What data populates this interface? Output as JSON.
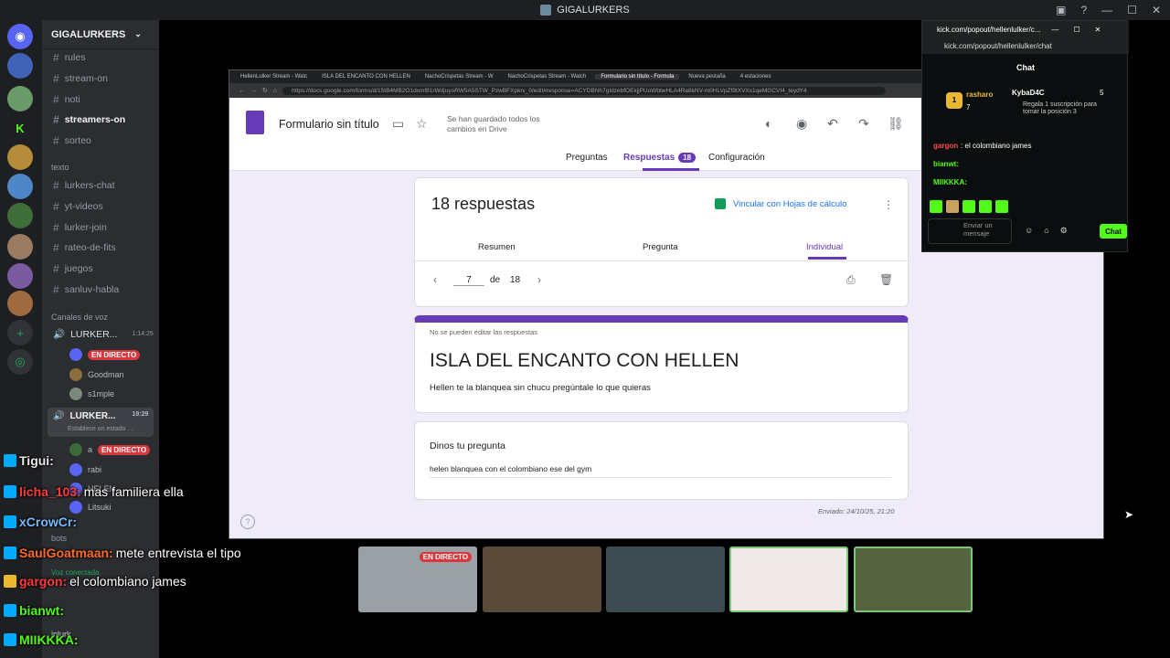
{
  "window": {
    "title": "GIGALURKERS"
  },
  "discord": {
    "server_name": "GIGALURKERS",
    "channels": [
      "rules",
      "stream-on",
      "noti",
      "streamers-on",
      "sorteo"
    ],
    "active_channel": "streamers-on",
    "text_category": "texto",
    "text_channels": [
      "lurkers-chat",
      "yt-videos",
      "lurker-join",
      "rateo-de-fits",
      "juegos",
      "sanluv-habla"
    ],
    "voice_category": "Canales de voz",
    "voice1": {
      "name": "LURKER...",
      "time": "1:14:25",
      "users": [
        "EN DIRECTO",
        "Goodman",
        "s1mple"
      ]
    },
    "voice2": {
      "name": "LURKER...",
      "time": "19:29",
      "status": "Establece un estado ..."
    },
    "voice2_users": [
      "a",
      "rabi",
      "HELEN",
      "Litsuki"
    ],
    "bots_label": "bots",
    "voice_connected": "Voz conectada",
    "live_badge": "EN DIRECTO",
    "user_footer": "inlurk"
  },
  "browser": {
    "tabs": [
      "HellenLulker Stream - Watc",
      "ISLA DEL ENCANTO CON HELLEN",
      "NachoCrispetas Stream - W",
      "NachoCrispetas Stream - Watch",
      "Formulario sin título - Formula",
      "Nueva pestaña",
      "4 estaciones"
    ],
    "url": "https://docs.google.com/forms/d/15tB4MB2O1dxmf81rWdjuyoRW5A5STW_PzwBFXpkrv_0/edit#response=ACYDBNh7gIdzebfOEkjjPUoWbtwHLA4Ra8kNV-m0HLVpZf9tXVXx1qeMGCVI4_teydY4"
  },
  "form": {
    "title": "Formulario sin título",
    "saved_status": "Se han guardado todos los cambios en Drive",
    "nav_tabs": [
      "Preguntas",
      "Respuestas",
      "Configuración"
    ],
    "response_count_badge": "18",
    "responses_heading": "18 respuestas",
    "sheet_link": "Vincular con Hojas de cálculo",
    "sub_tabs": [
      "Resumen",
      "Pregunta",
      "Individual"
    ],
    "pager": {
      "current": "7",
      "of_label": "de",
      "total": "18"
    },
    "no_edit_notice": "No se pueden editar las respuestas",
    "response_title": "ISLA DEL ENCANTO CON HELLEN",
    "response_desc": "Hellen te la blanquea sin chucu pregúntale lo que quieras",
    "question_label": "Dinos tu pregunta",
    "question_answer": "helen blanquea con el colombiano ese del gym",
    "submitted": "Enviado: 24/10/25, 21:20"
  },
  "kick": {
    "window_title": "kick.com/popout/hellenlulker/c...",
    "address": "kick.com/popout/hellenlulker/chat",
    "chat_header": "Chat",
    "gift": {
      "rank": "1",
      "user": "rasharo",
      "count": "7",
      "user2": "KybaD4C",
      "count2": "5",
      "message": "Regala 1 suscripción para tomar la posición 3"
    },
    "messages": [
      {
        "user": "gargon",
        "text": ": el colombiano james"
      },
      {
        "user": "bianwt:",
        "text": ""
      },
      {
        "user": "MIIKKKA:",
        "text": ""
      }
    ],
    "input_placeholder": "Enviar un mensaje",
    "chat_button": "Chat"
  },
  "overlay_chat": [
    {
      "user": "Tigui:",
      "text": ""
    },
    {
      "user": "licha_103:",
      "text": " mas familiera ella"
    },
    {
      "user": "xCrowCr:",
      "text": ""
    },
    {
      "user": "SaulGoatmaan:",
      "text": " mete entrevista el tipo"
    },
    {
      "user": "gargon:",
      "text": " el colombiano james"
    },
    {
      "user": "bianwt:",
      "text": ""
    },
    {
      "user": "MIIKKKA:",
      "text": ""
    }
  ],
  "thumbnails": {
    "live_badge": "EN DIRECTO"
  }
}
